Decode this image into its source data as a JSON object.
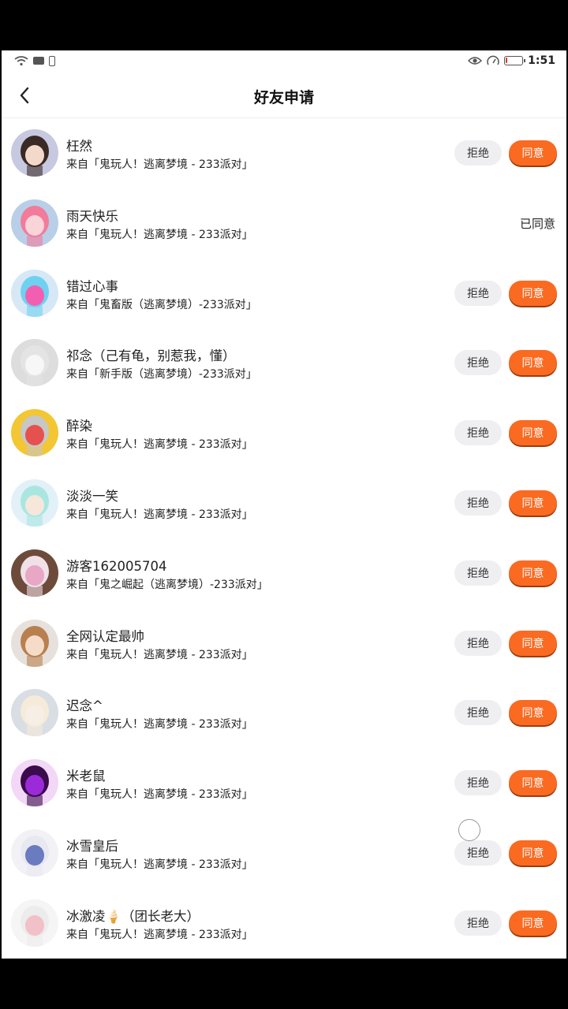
{
  "status_bar": {
    "time": "1:51",
    "battery_level": 0.08,
    "battery_color": "#e33333"
  },
  "header": {
    "title": "好友申请",
    "back_icon": "chevron-left-icon"
  },
  "buttons": {
    "reject_label": "拒绝",
    "agree_label": "同意",
    "agreed_label": "已同意"
  },
  "colors": {
    "agree_bg": "#fa6a21",
    "reject_bg": "#efeff2"
  },
  "requests": [
    {
      "name": "枉然",
      "source": "来自「鬼玩人！逃离梦境 - 233派对」",
      "status": "pending",
      "avatar_colors": [
        "#3a2a25",
        "#f3d9c9",
        "#c7c9e0"
      ]
    },
    {
      "name": "雨天快乐",
      "source": "来自「鬼玩人！逃离梦境 - 233派对」",
      "status": "agreed",
      "avatar_colors": [
        "#f27b9b",
        "#f9d4d8",
        "#b9cfe8"
      ]
    },
    {
      "name": "错过心事",
      "source": "来自「鬼畜版（逃离梦境）-233派对」",
      "status": "pending",
      "avatar_colors": [
        "#6fd1f0",
        "#f35fb0",
        "#d6e8f6"
      ]
    },
    {
      "name": "祁念（己有龟，别惹我，懂）",
      "source": "来自「新手版（逃离梦境）-233派对」",
      "status": "pending",
      "avatar_colors": [
        "#e4e4e4",
        "#f7f7f7",
        "#dddddd"
      ]
    },
    {
      "name": "醉染",
      "source": "来自「鬼玩人！逃离梦境 - 233派对」",
      "status": "pending",
      "avatar_colors": [
        "#c7c7c7",
        "#e4514e",
        "#f3c633"
      ]
    },
    {
      "name": "淡淡一笑",
      "source": "来自「鬼玩人！逃离梦境 - 233派对」",
      "status": "pending",
      "avatar_colors": [
        "#a9e6e2",
        "#f6e7da",
        "#e1f1f7"
      ]
    },
    {
      "name": "游客162005704",
      "source": "来自「鬼之崛起（逃离梦境）-233派对」",
      "status": "pending",
      "avatar_colors": [
        "#f0e0e8",
        "#e8a7c4",
        "#6d4b3b"
      ]
    },
    {
      "name": "全网认定最帅",
      "source": "来自「鬼玩人！逃离梦境 - 233派对」",
      "status": "pending",
      "avatar_colors": [
        "#b9804f",
        "#f4dcc8",
        "#e6e1dc"
      ]
    },
    {
      "name": "迟念^",
      "source": "来自「鬼玩人！逃离梦境 - 233派对」",
      "status": "pending",
      "avatar_colors": [
        "#f5ebd8",
        "#f7efe6",
        "#d9dde4"
      ]
    },
    {
      "name": "米老鼠",
      "source": "来自「鬼玩人！逃离梦境 - 233派对」",
      "status": "pending",
      "avatar_colors": [
        "#3a0b4d",
        "#9b2bd8",
        "#f2d7f6"
      ]
    },
    {
      "name": "冰雪皇后",
      "source": "来自「鬼玩人！逃离梦境 - 233派对」",
      "status": "pending",
      "avatar_colors": [
        "#e8e8f0",
        "#6b7bbf",
        "#f2f2f6"
      ]
    },
    {
      "name": "冰激凌🍦（团长老大）",
      "source": "来自「鬼玩人！逃离梦境 - 233派对」",
      "status": "pending",
      "avatar_colors": [
        "#ececec",
        "#f1c1c7",
        "#f5f5f5"
      ]
    }
  ]
}
